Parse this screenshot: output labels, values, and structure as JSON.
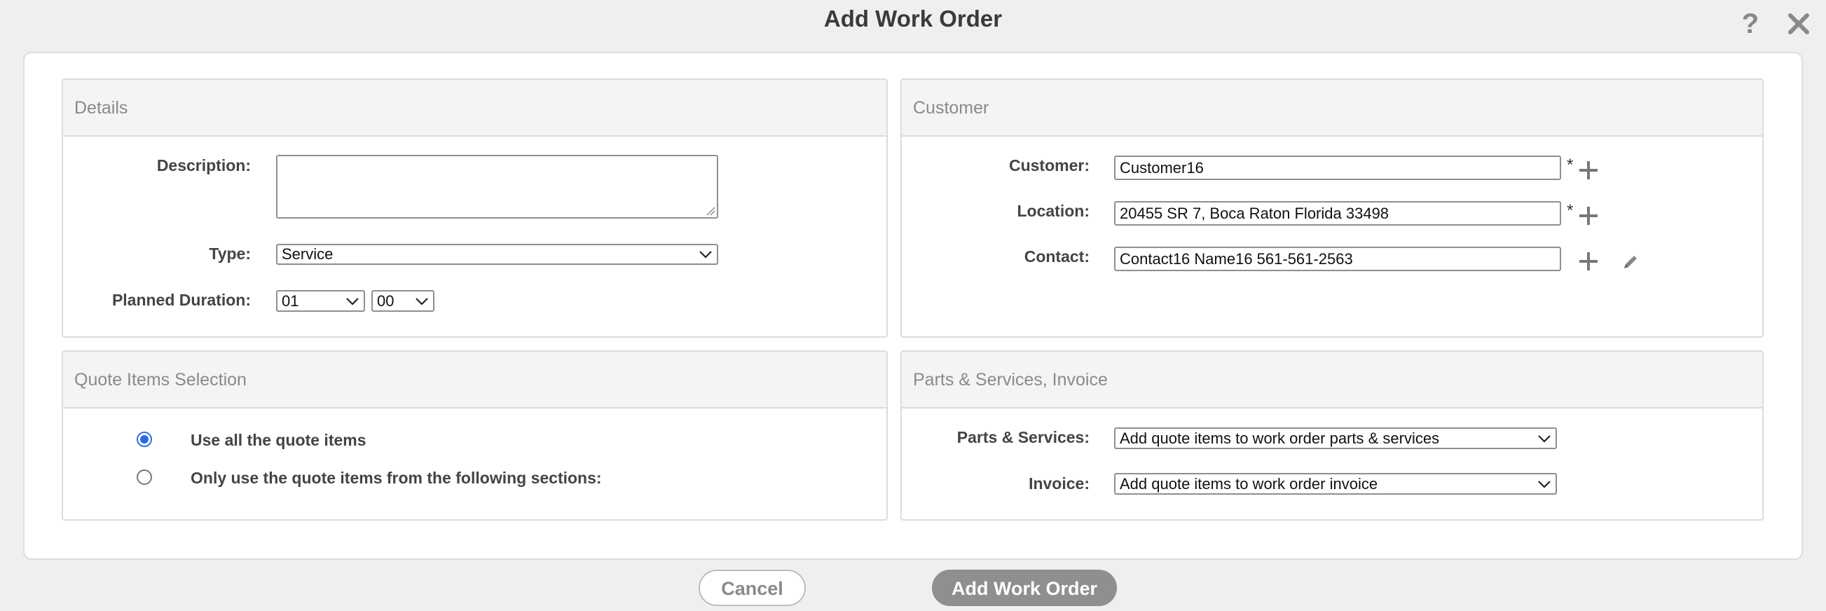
{
  "dialog": {
    "title": "Add Work Order"
  },
  "details": {
    "header": "Details",
    "description_label": "Description:",
    "description_value": "",
    "type_label": "Type:",
    "type_value": "Service",
    "duration_label": "Planned Duration:",
    "duration_hours": "01",
    "duration_minutes": "00"
  },
  "customer": {
    "header": "Customer",
    "customer_label": "Customer:",
    "customer_value": "Customer16",
    "location_label": "Location:",
    "location_value": "20455 SR 7, Boca Raton Florida  33498",
    "contact_label": "Contact:",
    "contact_value": "Contact16 Name16 561-561-2563",
    "required_mark": "*"
  },
  "quote_items": {
    "header": "Quote Items Selection",
    "option_all": "Use all the quote items",
    "option_sections": "Only use the quote items from the following sections:",
    "selected": "all"
  },
  "parts_invoice": {
    "header": "Parts & Services, Invoice",
    "parts_label": "Parts & Services:",
    "parts_value": "Add quote items to work order parts & services",
    "invoice_label": "Invoice:",
    "invoice_value": "Add quote items to work order invoice"
  },
  "buttons": {
    "cancel": "Cancel",
    "add": "Add Work Order"
  },
  "colors": {
    "accent": "#2d6cdf",
    "disabled_button": "#8f8f8f"
  }
}
